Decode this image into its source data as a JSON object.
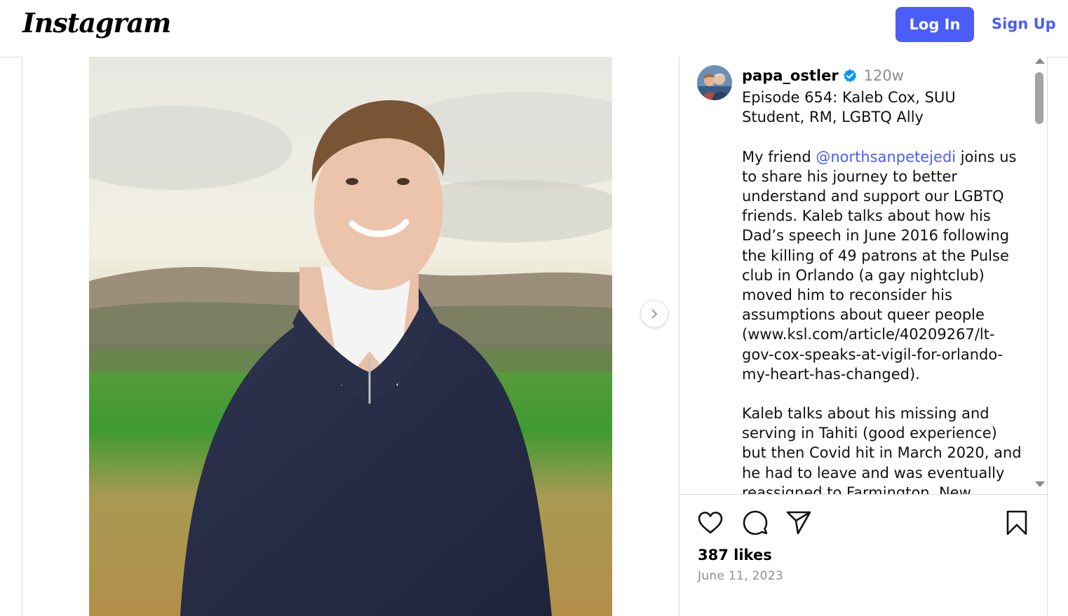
{
  "header": {
    "logo": "Instagram",
    "login_label": "Log In",
    "signup_label": "Sign Up"
  },
  "post": {
    "username": "papa_ostler",
    "time_ago": "120w",
    "caption_title": "Episode 654:  Kaleb Cox, SUU Student, RM, LGBTQ Ally",
    "caption_p2_before": "My friend ",
    "mention": "@northsanpetejedi",
    "caption_p2_after": "  joins us to share his journey to better understand and support our LGBTQ friends.  Kaleb talks about how his Dad’s speech in June 2016 following the killing of 49 patrons at the Pulse club in Orlando (a gay nightclub) moved him to reconsider his assumptions about queer people (www.ksl.com/article/40209267/lt-gov-cox-speaks-at-vigil-for-orlando-my-heart-has-changed).",
    "caption_p3": "Kaleb talks about his missing and serving in Tahiti (good experience) but then Covid hit in March 2020, and he had to leave and was eventually reassigned to Farmington, New Mexico.",
    "likes": "387 likes",
    "date": "June 11, 2023"
  },
  "icons": {
    "verified": "verified-badge-icon",
    "like": "heart-icon",
    "comment": "comment-icon",
    "share": "share-icon",
    "save": "bookmark-icon",
    "next": "chevron-right-icon"
  },
  "colors": {
    "accent": "#4a5df9",
    "verified": "#0095f6",
    "muted": "#8e8e8e",
    "border": "#dbdbdb"
  }
}
